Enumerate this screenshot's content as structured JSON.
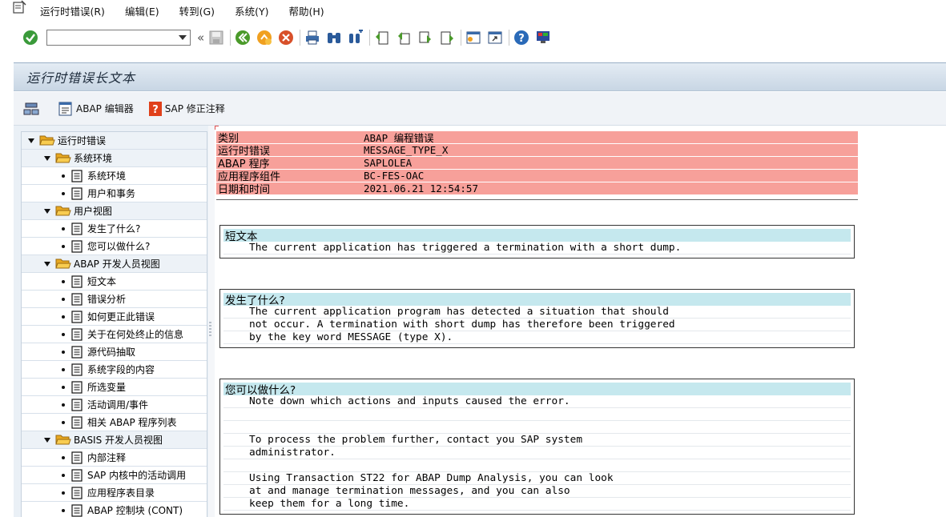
{
  "menu": [
    {
      "label": "运行时错误(R)"
    },
    {
      "label": "编辑(E)"
    },
    {
      "label": "转到(G)"
    },
    {
      "label": "系统(Y)"
    },
    {
      "label": "帮助(H)"
    }
  ],
  "toolbar": {
    "command_value": "",
    "icons": [
      "enter-check-icon",
      "save-icon",
      "back-icon",
      "exit-icon",
      "cancel-icon",
      "print-icon",
      "find-icon",
      "find-next-icon",
      "first-page-icon",
      "previous-page-icon",
      "next-page-icon",
      "last-page-icon",
      "create-session-icon",
      "shortcut-icon",
      "help-icon",
      "layout-icon"
    ]
  },
  "title": "运行时错误长文本",
  "app_toolbar": {
    "editor_label": "ABAP 编辑器",
    "correction_label": "SAP 修正注释"
  },
  "tree": [
    {
      "type": "folder",
      "level": 0,
      "label": "运行时错误"
    },
    {
      "type": "folder",
      "level": 1,
      "label": "系统环境"
    },
    {
      "type": "doc",
      "level": 2,
      "label": "系统环境"
    },
    {
      "type": "doc",
      "level": 2,
      "label": "用户和事务"
    },
    {
      "type": "folder",
      "level": 1,
      "label": "用户视图"
    },
    {
      "type": "doc",
      "level": 2,
      "label": "发生了什么?"
    },
    {
      "type": "doc",
      "level": 2,
      "label": "您可以做什么?"
    },
    {
      "type": "folder",
      "level": 1,
      "label": "ABAP 开发人员视图"
    },
    {
      "type": "doc",
      "level": 2,
      "label": "短文本"
    },
    {
      "type": "doc",
      "level": 2,
      "label": "错误分析"
    },
    {
      "type": "doc",
      "level": 2,
      "label": "如何更正此错误"
    },
    {
      "type": "doc",
      "level": 2,
      "label": "关于在何处终止的信息"
    },
    {
      "type": "doc",
      "level": 2,
      "label": "源代码抽取"
    },
    {
      "type": "doc",
      "level": 2,
      "label": "系统字段的内容"
    },
    {
      "type": "doc",
      "level": 2,
      "label": "所选变量"
    },
    {
      "type": "doc",
      "level": 2,
      "label": "活动调用/事件"
    },
    {
      "type": "doc",
      "level": 2,
      "label": "相关 ABAP 程序列表"
    },
    {
      "type": "folder",
      "level": 1,
      "label": "BASIS 开发人员视图"
    },
    {
      "type": "doc",
      "level": 2,
      "label": "内部注释"
    },
    {
      "type": "doc",
      "level": 2,
      "label": "SAP 内核中的活动调用"
    },
    {
      "type": "doc",
      "level": 2,
      "label": "应用程序表目录"
    },
    {
      "type": "doc",
      "level": 2,
      "label": "ABAP 控制块 (CONT)"
    }
  ],
  "header": [
    {
      "key": "类别",
      "value": "ABAP 编程错误"
    },
    {
      "key": "运行时错误",
      "value": "MESSAGE_TYPE_X"
    },
    {
      "key": "ABAP 程序",
      "value": "SAPLOLEA"
    },
    {
      "key": "应用程序组件",
      "value": "BC-FES-OAC"
    },
    {
      "key": "日期和时间",
      "value": "2021.06.21 12:54:57"
    }
  ],
  "sections": [
    {
      "title": "短文本",
      "lines": [
        "The current application has triggered a termination with a short dump."
      ]
    },
    {
      "title": "发生了什么?",
      "lines": [
        "The current application program has detected a situation that should",
        "not occur. A termination with short dump has therefore been triggered",
        "by the key word MESSAGE (type X)."
      ]
    },
    {
      "title": "您可以做什么?",
      "lines": [
        "Note down which actions and inputs caused the error.",
        "",
        "",
        "To process the problem further, contact you SAP system",
        "administrator.",
        "",
        "Using Transaction ST22 for ABAP Dump Analysis, you can look",
        "at and manage termination messages, and you can also",
        "keep them for a long time."
      ]
    }
  ],
  "colors": {
    "header_bg": "#f7a09a",
    "section_header_bg": "#c5e8ee",
    "title_bar": "#c8d6e4"
  }
}
